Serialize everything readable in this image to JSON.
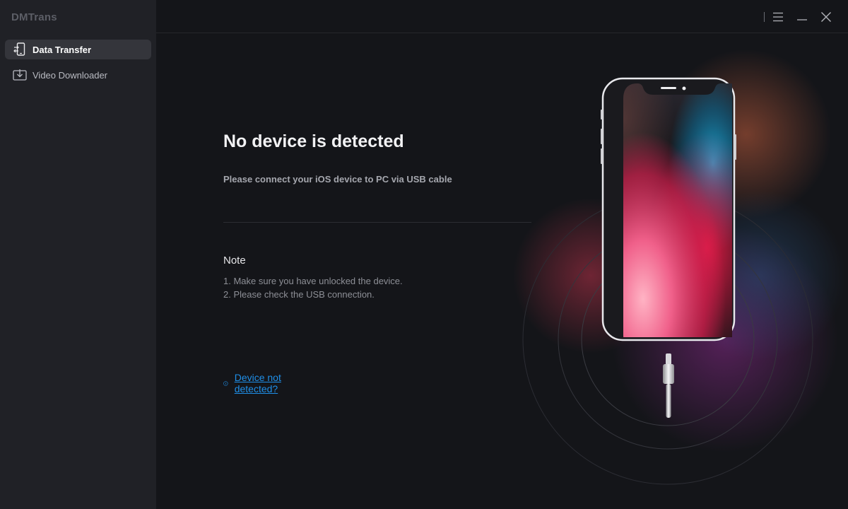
{
  "app": {
    "title": "DMTrans"
  },
  "sidebar": {
    "items": [
      {
        "label": "Data Transfer",
        "icon": "phone-transfer-icon",
        "active": true
      },
      {
        "label": "Video Downloader",
        "icon": "video-download-icon",
        "active": false
      }
    ]
  },
  "window_controls": {
    "icons": [
      "menu-icon",
      "minimize-icon",
      "close-icon"
    ]
  },
  "main": {
    "headline": "No device is detected",
    "subline": "Please connect your iOS device to PC via USB cable",
    "note": {
      "title": "Note",
      "lines": [
        "1. Make sure you have unlocked the device.",
        "2. Please check the USB connection."
      ]
    },
    "help_link": {
      "label": "Device not detected?",
      "icon": "info-circle-icon"
    }
  },
  "colors": {
    "sidebar_bg": "#202126",
    "main_bg": "#141519",
    "active_item_bg": "#34353b",
    "link": "#1f8fe8"
  }
}
